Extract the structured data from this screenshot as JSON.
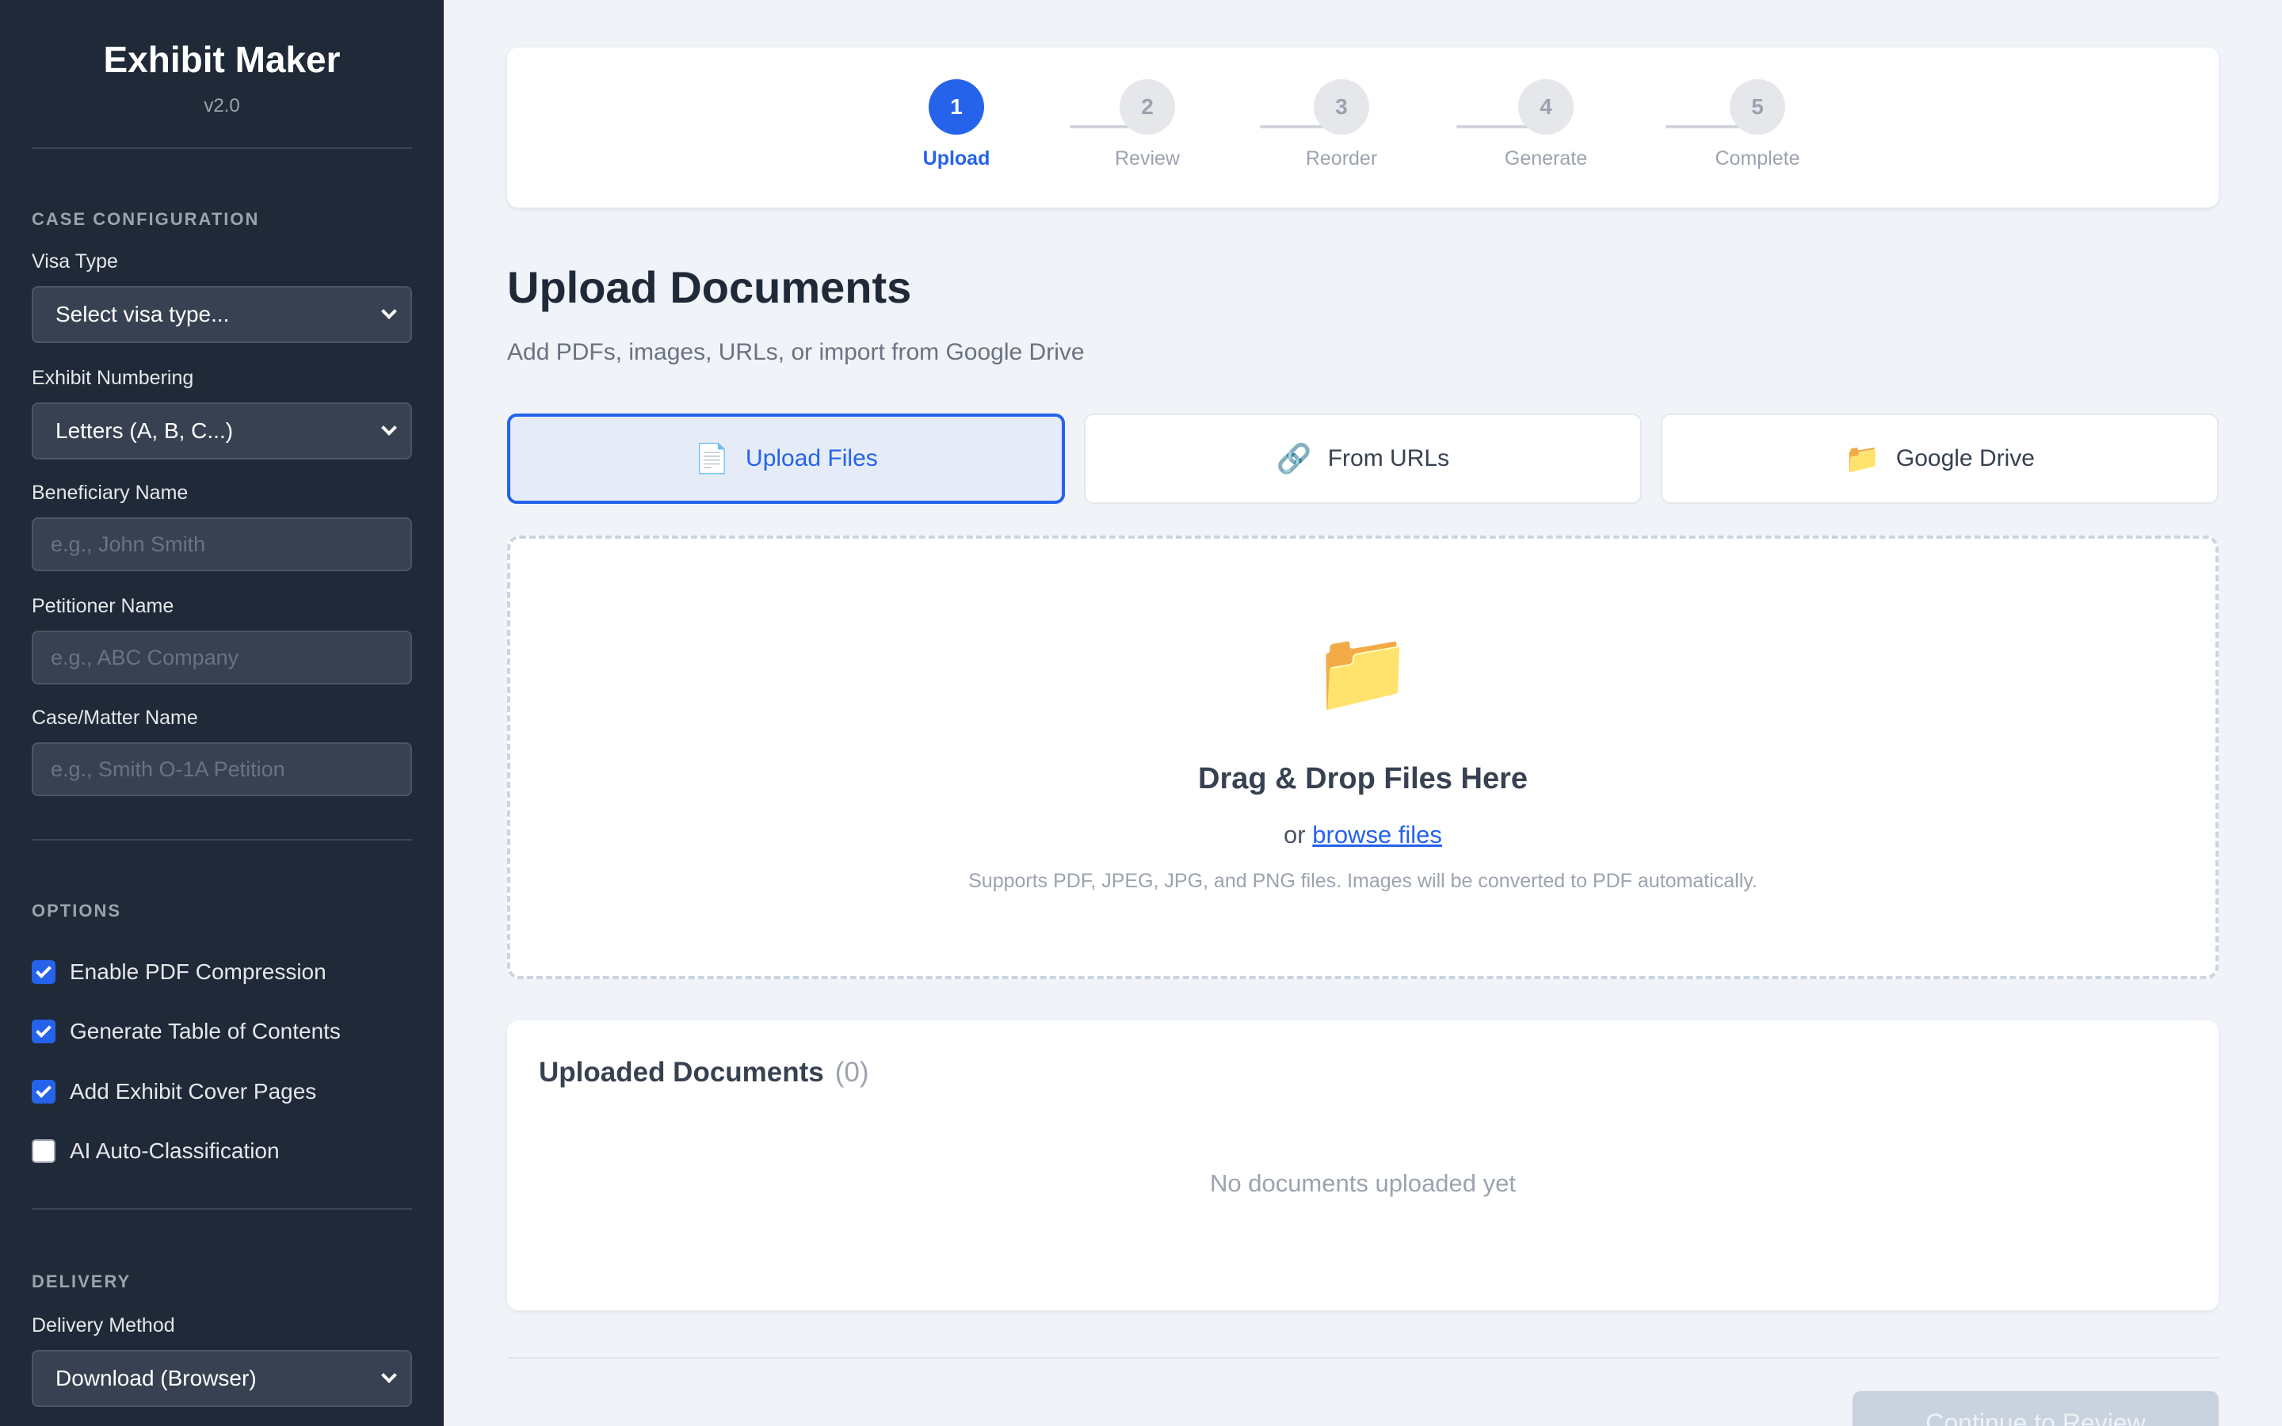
{
  "sidebar": {
    "app_title": "Exhibit Maker",
    "version": "v2.0",
    "case_configuration": {
      "section_title": "CASE CONFIGURATION",
      "visa_type": {
        "label": "Visa Type",
        "value": "Select visa type..."
      },
      "exhibit_numbering": {
        "label": "Exhibit Numbering",
        "value": "Letters (A, B, C...)"
      },
      "beneficiary_name": {
        "label": "Beneficiary Name",
        "placeholder": "e.g., John Smith"
      },
      "petitioner_name": {
        "label": "Petitioner Name",
        "placeholder": "e.g., ABC Company"
      },
      "case_matter_name": {
        "label": "Case/Matter Name",
        "placeholder": "e.g., Smith O-1A Petition"
      }
    },
    "options": {
      "section_title": "OPTIONS",
      "items": [
        {
          "label": "Enable PDF Compression",
          "checked": true
        },
        {
          "label": "Generate Table of Contents",
          "checked": true
        },
        {
          "label": "Add Exhibit Cover Pages",
          "checked": true
        },
        {
          "label": "AI Auto-Classification",
          "checked": false
        }
      ]
    },
    "delivery": {
      "section_title": "DELIVERY",
      "method": {
        "label": "Delivery Method",
        "value": "Download (Browser)"
      }
    }
  },
  "stepper": {
    "current_step": 1,
    "steps": [
      {
        "number": "1",
        "label": "Upload"
      },
      {
        "number": "2",
        "label": "Review"
      },
      {
        "number": "3",
        "label": "Reorder"
      },
      {
        "number": "4",
        "label": "Generate"
      },
      {
        "number": "5",
        "label": "Complete"
      }
    ]
  },
  "main": {
    "title": "Upload Documents",
    "subtitle": "Add PDFs, images, URLs, or import from Google Drive",
    "tabs": [
      {
        "label": "Upload Files",
        "icon": "document-icon",
        "glyph": "📄",
        "active": true
      },
      {
        "label": "From URLs",
        "icon": "link-icon",
        "glyph": "🔗",
        "active": false
      },
      {
        "label": "Google Drive",
        "icon": "folder-icon",
        "glyph": "📁",
        "active": false
      }
    ],
    "dropzone": {
      "icon": "folder-icon",
      "glyph": "📁",
      "title": "Drag & Drop Files Here",
      "or_text": "or",
      "browse_link": "browse files",
      "hint": "Supports PDF, JPEG, JPG, and PNG files. Images will be converted to PDF automatically."
    },
    "uploaded": {
      "title": "Uploaded Documents",
      "count": "(0)",
      "empty_text": "No documents uploaded yet"
    },
    "continue_button": "Continue to Review"
  },
  "colors": {
    "sidebar_bg": "#1f2937",
    "accent": "#2563eb",
    "page_bg": "#f0f3f8",
    "disabled_button": "#c9d2df"
  }
}
